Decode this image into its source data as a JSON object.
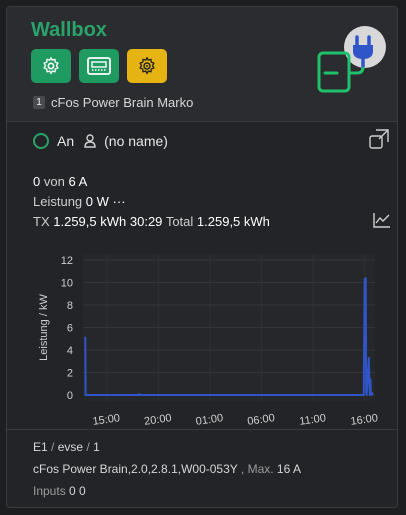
{
  "header": {
    "title": "Wallbox",
    "buttons": [
      {
        "icon": "gear-icon",
        "color": "#1f9a60"
      },
      {
        "icon": "meter-icon",
        "color": "#1f9a60"
      },
      {
        "icon": "gear-warning-icon",
        "color": "#e5b413"
      }
    ],
    "device_index": "1",
    "device_name": "cFos Power Brain Marko"
  },
  "status": {
    "state": "An",
    "user": "(no name)"
  },
  "current": {
    "value": "0",
    "of": "von",
    "max": "6 A"
  },
  "power": {
    "label": "Leistung",
    "value": "0 W",
    "phases": "···"
  },
  "energy": {
    "tx_label": "TX",
    "tx_value": "1.259,5 kWh",
    "duration": "30:29",
    "total_label": "Total",
    "total_value": "1.259,5 kWh"
  },
  "chart_data": {
    "type": "line",
    "ylabel": "Leistung / kW",
    "ylim": [
      0,
      12
    ],
    "yticks": [
      0,
      2,
      4,
      6,
      8,
      10,
      12
    ],
    "xticks": [
      "15:00",
      "20:00",
      "01:00",
      "06:00",
      "11:00",
      "16:00"
    ],
    "xlim_hours": [
      12.7,
      17.4
    ],
    "series": [
      {
        "color": "#2f55c9",
        "x": [
          12.9,
          12.92,
          12.95,
          13.1,
          18.1,
          18.15,
          18.2,
          39.9,
          40.0,
          40.05,
          40.1,
          40.15,
          40.2,
          40.4,
          40.5,
          40.55,
          40.6,
          40.7,
          40.8
        ],
        "y": [
          4.8,
          5.1,
          0.0,
          0.0,
          0.0,
          0.1,
          0.0,
          0.0,
          10.3,
          10.3,
          10.4,
          0.2,
          0.0,
          3.3,
          0.0,
          1.4,
          0.0,
          0.2,
          0.0
        ]
      }
    ]
  },
  "footer": {
    "path": [
      "E1",
      "evse",
      "1"
    ],
    "sep": "/",
    "model": "cFos Power Brain,2.0,2.8.1,W00-053Y",
    "max_label": ", Max.",
    "max_value": "16 A",
    "inputs_label": "Inputs",
    "inputs_value": "0 0"
  }
}
